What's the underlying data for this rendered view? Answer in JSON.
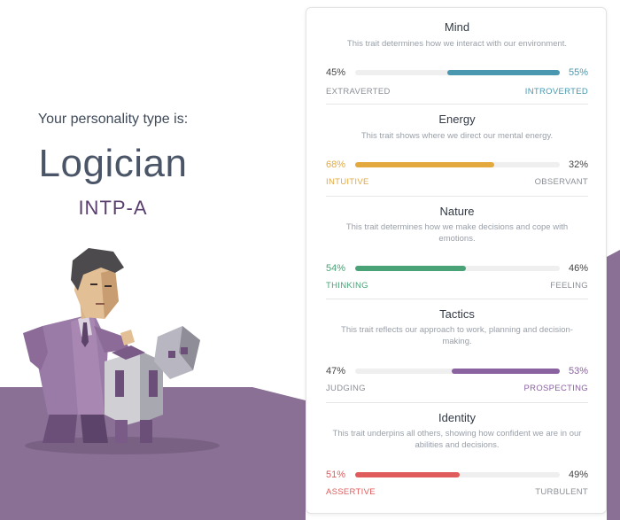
{
  "intro_text": "Your personality type is:",
  "type_name": "Logician",
  "type_code": "INTP-A",
  "colors": {
    "background_wedge": "#8a7095",
    "mind": "#4a98b0",
    "energy": "#e3a93f",
    "nature": "#4aa377",
    "tactics": "#8a62a0",
    "identity": "#e05c5c"
  },
  "traits": [
    {
      "title": "Mind",
      "description": "This trait determines how we interact with our environment.",
      "left_pct": "45%",
      "right_pct": "55%",
      "left_label": "EXTRAVERTED",
      "right_label": "INTROVERTED",
      "dominant": "right",
      "dominant_value": 0.55
    },
    {
      "title": "Energy",
      "description": "This trait shows where we direct our mental energy.",
      "left_pct": "68%",
      "right_pct": "32%",
      "left_label": "INTUITIVE",
      "right_label": "OBSERVANT",
      "dominant": "left",
      "dominant_value": 0.68
    },
    {
      "title": "Nature",
      "description": "This trait determines how we make decisions and cope with emotions.",
      "left_pct": "54%",
      "right_pct": "46%",
      "left_label": "THINKING",
      "right_label": "FEELING",
      "dominant": "left",
      "dominant_value": 0.54
    },
    {
      "title": "Tactics",
      "description": "This trait reflects our approach to work, planning and decision-making.",
      "left_pct": "47%",
      "right_pct": "53%",
      "left_label": "JUDGING",
      "right_label": "PROSPECTING",
      "dominant": "right",
      "dominant_value": 0.53
    },
    {
      "title": "Identity",
      "description": "This trait underpins all others, showing how confident we are in our abilities and decisions.",
      "left_pct": "51%",
      "right_pct": "49%",
      "left_label": "ASSERTIVE",
      "right_label": "TURBULENT",
      "dominant": "left",
      "dominant_value": 0.51
    }
  ]
}
